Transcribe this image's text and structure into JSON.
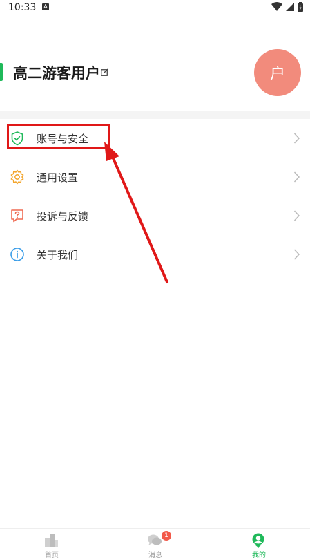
{
  "status_bar": {
    "time": "10:33",
    "notification_letter": "A"
  },
  "profile": {
    "username": "高二游客用户",
    "avatar_text": "户"
  },
  "menu": {
    "items": [
      {
        "label": "账号与安全",
        "icon": "shield-check-icon"
      },
      {
        "label": "通用设置",
        "icon": "gear-icon"
      },
      {
        "label": "投诉与反馈",
        "icon": "feedback-icon"
      },
      {
        "label": "关于我们",
        "icon": "info-icon"
      }
    ]
  },
  "bottom_nav": {
    "items": [
      {
        "label": "首页",
        "icon": "home-icon",
        "active": false
      },
      {
        "label": "消息",
        "icon": "chat-icon",
        "active": false,
        "badge": "1"
      },
      {
        "label": "我的",
        "icon": "profile-icon",
        "active": true
      }
    ]
  },
  "colors": {
    "accent": "#1fb95a",
    "avatar": "#f28b7c",
    "annotation": "#e01818"
  }
}
